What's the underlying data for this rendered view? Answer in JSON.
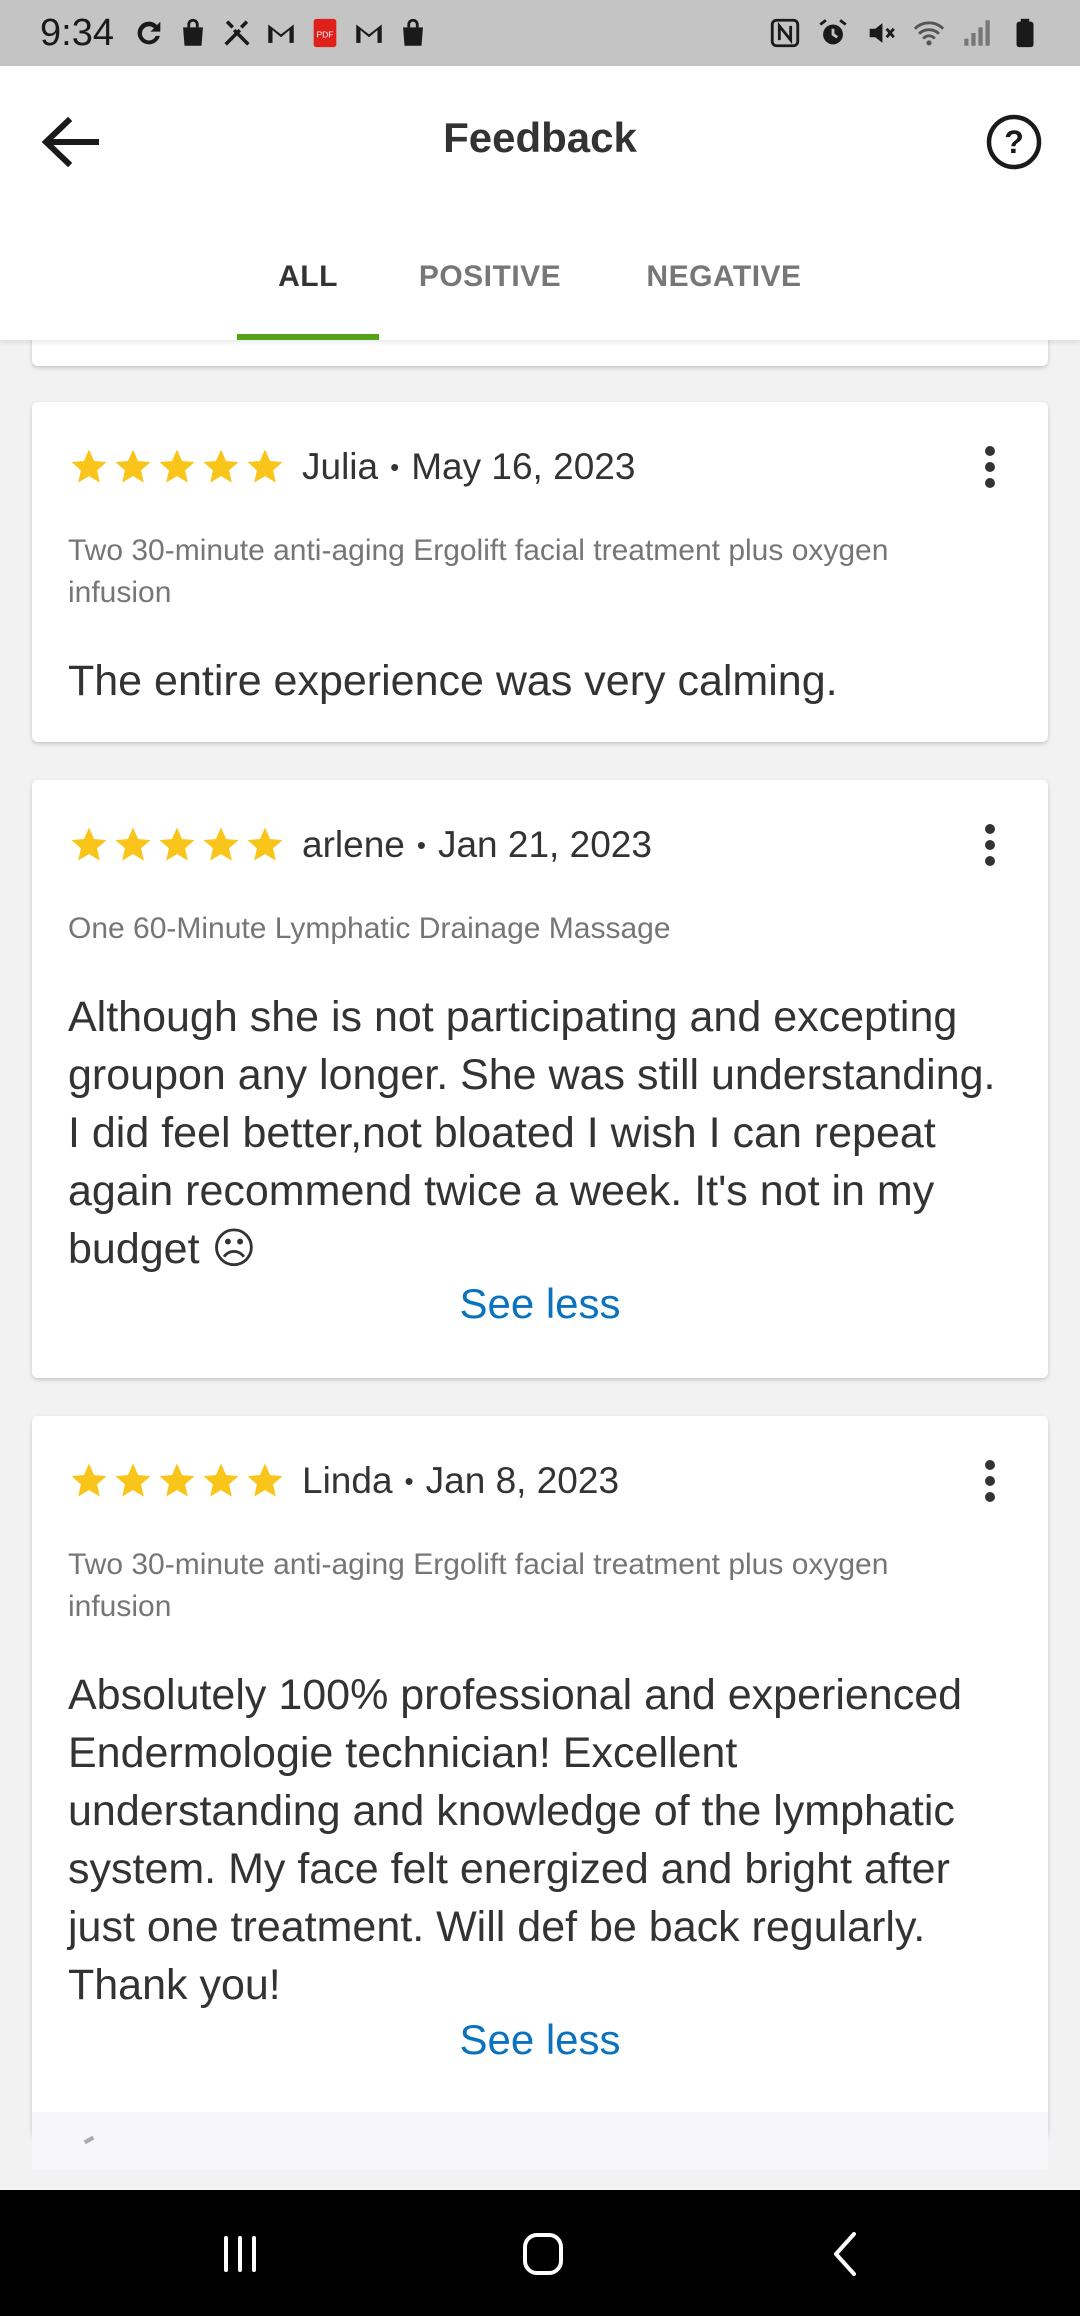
{
  "status_bar": {
    "time": "9:34",
    "left_icons": [
      "sync-icon",
      "shopping-bag-icon",
      "tools-icon",
      "gmail-icon",
      "pdf-icon",
      "gmail-icon",
      "shopping-bag-icon"
    ],
    "right_icons": [
      "nfc-icon",
      "alarm-icon",
      "mute-icon",
      "wifi-icon",
      "signal-icon",
      "battery-icon"
    ],
    "pdf_label": "PDF"
  },
  "header": {
    "title": "Feedback",
    "back_icon": "arrow-left-icon",
    "help_icon": "question-circle-icon",
    "help_symbol": "?"
  },
  "tabs": [
    {
      "label": "ALL",
      "active": true
    },
    {
      "label": "POSITIVE",
      "active": false
    },
    {
      "label": "NEGATIVE",
      "active": false
    }
  ],
  "colors": {
    "tab_indicator": "#53a318",
    "star": "#f9c51b",
    "link": "#0a72be"
  },
  "reviews": [
    {
      "rating": 5,
      "name": "Julia",
      "separator": "•",
      "date": "May 16, 2023",
      "deal": "Two 30-minute anti-aging Ergolift facial treatment plus oxygen infusion",
      "text": "The entire experience was very calming.",
      "toggle": ""
    },
    {
      "rating": 5,
      "name": "arlene",
      "separator": "•",
      "date": "Jan 21, 2023",
      "deal": "One 60-Minute Lymphatic Drainage Massage",
      "text": "Although she is not participating and excepting groupon any longer.  She was still understanding. I did feel better,not bloated  I wish I can repeat again recommend twice a week. It's not in my budget ☹",
      "toggle": "See less"
    },
    {
      "rating": 5,
      "name": "Linda",
      "separator": "•",
      "date": "Jan 8, 2023",
      "deal": "Two 30-minute anti-aging Ergolift facial treatment plus oxygen infusion",
      "text": "Absolutely 100% professional and experienced Endermologie technician! Excellent understanding and  knowledge of the lymphatic system. My face felt energized  and bright after just one treatment. Will def be back regularly. Thank you!",
      "toggle": "See less"
    }
  ],
  "nav_bar": {
    "buttons": [
      "recents-icon",
      "home-icon",
      "back-icon"
    ]
  }
}
